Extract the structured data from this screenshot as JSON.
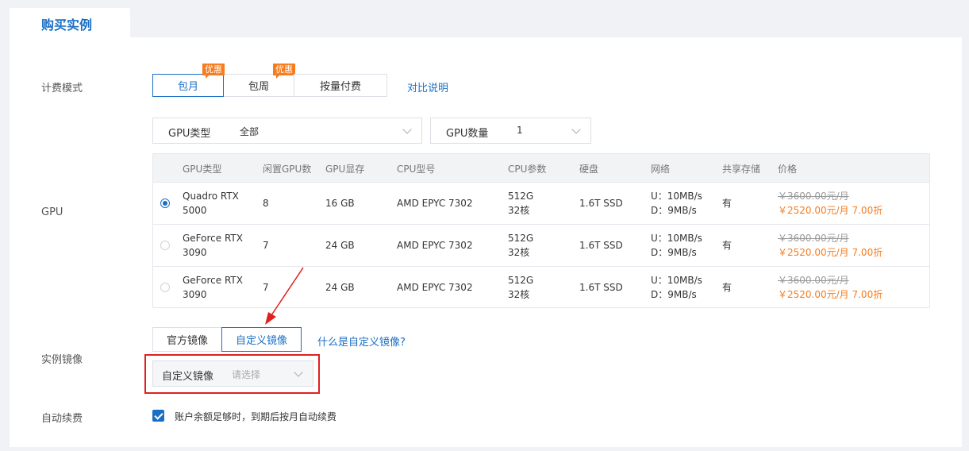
{
  "tab": {
    "title": "购买实例"
  },
  "billing": {
    "label": "计费模式",
    "options": [
      {
        "label": "包月",
        "badge": "优惠",
        "active": true
      },
      {
        "label": "包周",
        "badge": "优惠",
        "active": false
      },
      {
        "label": "按量付费",
        "badge": "",
        "active": false
      }
    ],
    "compare_link": "对比说明"
  },
  "gpu": {
    "label": "GPU",
    "type_select": {
      "label": "GPU类型",
      "value": "全部"
    },
    "count_select": {
      "label": "GPU数量",
      "value": "1"
    },
    "columns": [
      "GPU类型",
      "闲置GPU数",
      "GPU显存",
      "CPU型号",
      "CPU参数",
      "硬盘",
      "网络",
      "共享存储",
      "价格"
    ],
    "rows": [
      {
        "selected": true,
        "gpu_type": [
          "Quadro RTX",
          "5000"
        ],
        "idle": "8",
        "vram": "16 GB",
        "cpu_model": "AMD EPYC 7302",
        "cpu_params": [
          "512G",
          "32核"
        ],
        "disk": "1.6T SSD",
        "network": [
          "U：10MB/s",
          "D：9MB/s"
        ],
        "shared": "有",
        "orig_price": "￥3600.00元/月",
        "price": "￥2520.00元/月 7.00折"
      },
      {
        "selected": false,
        "gpu_type": [
          "GeForce RTX",
          "3090"
        ],
        "idle": "7",
        "vram": "24 GB",
        "cpu_model": "AMD EPYC 7302",
        "cpu_params": [
          "512G",
          "32核"
        ],
        "disk": "1.6T SSD",
        "network": [
          "U：10MB/s",
          "D：9MB/s"
        ],
        "shared": "有",
        "orig_price": "￥3600.00元/月",
        "price": "￥2520.00元/月 7.00折"
      },
      {
        "selected": false,
        "gpu_type": [
          "GeForce RTX",
          "3090"
        ],
        "idle": "7",
        "vram": "24 GB",
        "cpu_model": "AMD EPYC 7302",
        "cpu_params": [
          "512G",
          "32核"
        ],
        "disk": "1.6T SSD",
        "network": [
          "U：10MB/s",
          "D：9MB/s"
        ],
        "shared": "有",
        "orig_price": "￥3600.00元/月",
        "price": "￥2520.00元/月 7.00折"
      }
    ]
  },
  "image": {
    "label": "实例镜像",
    "options": [
      {
        "label": "官方镜像",
        "active": false
      },
      {
        "label": "自定义镜像",
        "active": true
      }
    ],
    "help_link": "什么是自定义镜像?",
    "select": {
      "label": "自定义镜像",
      "placeholder": "请选择"
    }
  },
  "renew": {
    "label": "自动续费",
    "checked": true,
    "text": "账户余额足够时，到期后按月自动续费"
  },
  "colors": {
    "accent": "#1a6fc4",
    "price": "#f57c1f",
    "highlight": "#e02020"
  }
}
